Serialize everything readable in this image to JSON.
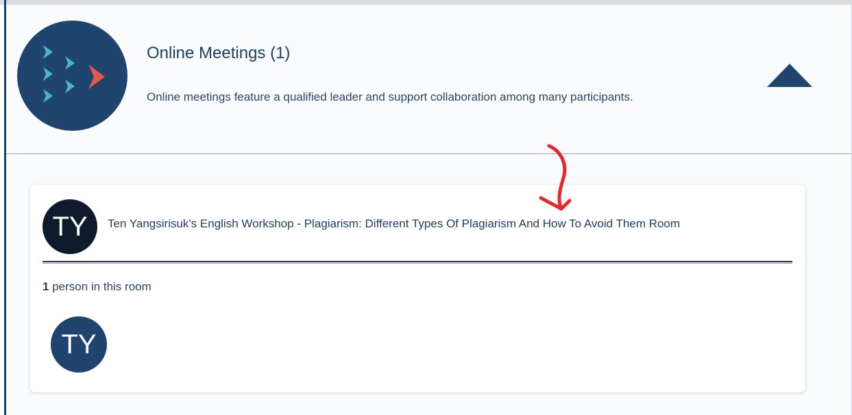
{
  "section": {
    "title": "Online Meetings (1)",
    "description": "Online meetings feature a qualified leader and support collaboration among many participants.",
    "logo_icon": "fish-school-icon",
    "collapse_icon": "triangle-up-icon",
    "colors": {
      "primary": "#1f446e",
      "logo_teal": "#4fb3c9",
      "logo_red": "#e05a4b",
      "annotation": "#e8262b"
    }
  },
  "room": {
    "host_initials": "TY",
    "name": "Ten Yangsirisuk's English Workshop - Plagiarism: Different Types Of Plagiarism And How To Avoid Them Room",
    "people_count": "1",
    "people_label": " person in this room",
    "participants": [
      {
        "initials": "TY"
      }
    ]
  }
}
